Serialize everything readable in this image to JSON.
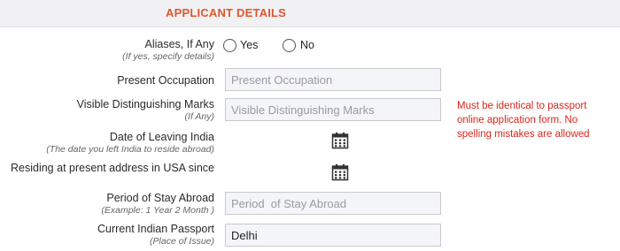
{
  "section": {
    "title": "APPLICANT DETAILS"
  },
  "aliases": {
    "label": "Aliases, If Any",
    "sublabel": "(If yes, specify details)",
    "options": [
      "Yes",
      "No"
    ]
  },
  "occupation": {
    "label": "Present Occupation",
    "placeholder": "Present Occupation"
  },
  "marks": {
    "label": "Visible Distinguishing Marks",
    "sublabel": "(If Any)",
    "placeholder": "Visible Distinguishing Marks"
  },
  "leaving_date": {
    "label": "Date of Leaving India",
    "sublabel": "(The date you left India to reside abroad)"
  },
  "residing_since": {
    "label": "Residing at present address in USA since"
  },
  "stay_period": {
    "label": "Period of Stay Abroad",
    "sublabel": "(Example: 1 Year 2 Month )",
    "placeholder": "Period  of Stay Abroad"
  },
  "passport": {
    "label": "Current Indian Passport",
    "sublabel": "(Place of Issue)",
    "value": "Delhi"
  },
  "note": "Must be identical to passport online application form. No spelling mistakes are allowed",
  "icons": {
    "calendar": "calendar-icon"
  },
  "colors": {
    "accent": "#e0552e",
    "warning": "#d9261c"
  }
}
